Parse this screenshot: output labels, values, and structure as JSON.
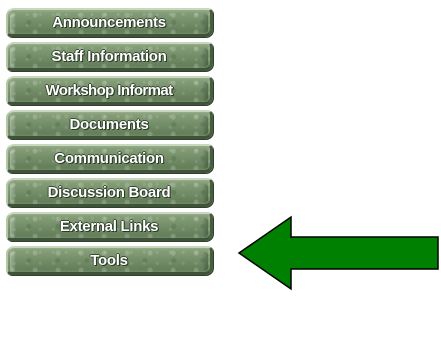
{
  "nav": {
    "items": [
      {
        "label": "Announcements"
      },
      {
        "label": "Staff Information"
      },
      {
        "label": "Workshop Informat"
      },
      {
        "label": "Documents"
      },
      {
        "label": "Communication"
      },
      {
        "label": "Discussion Board"
      },
      {
        "label": "External Links"
      },
      {
        "label": "Tools"
      }
    ]
  },
  "arrow": {
    "icon": "left-arrow-icon",
    "fill_color": "#008000",
    "stroke_color": "#000000"
  },
  "colors": {
    "button_green": "#75906a",
    "button_text": "#ffffff",
    "background": "#ffffff"
  }
}
